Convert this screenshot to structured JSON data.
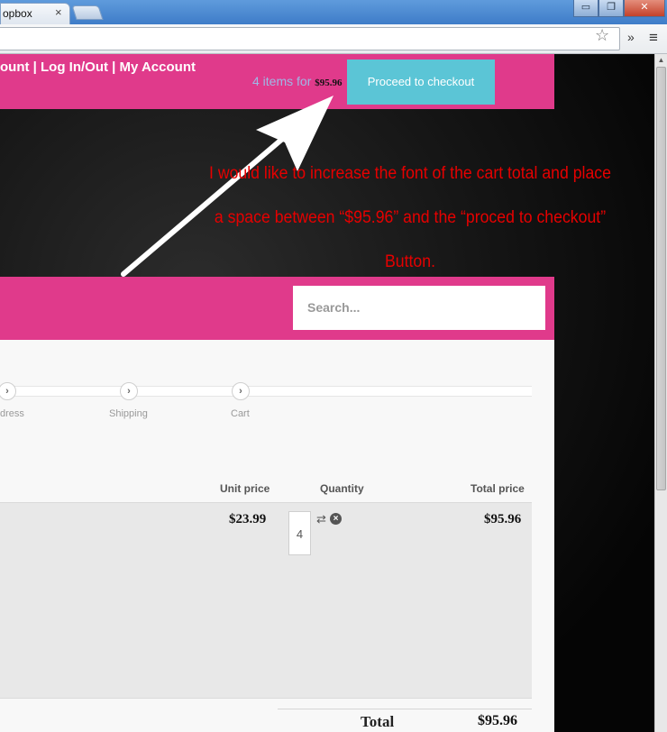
{
  "browser": {
    "tab_title": "opbox",
    "tab_close": "×",
    "window_min": "▭",
    "window_max": "❐",
    "window_close": "✕",
    "star_icon": "☆",
    "extensions_icon": "»",
    "menu_icon": "≡"
  },
  "header": {
    "account_links": "ount  | Log In/Out | My Account",
    "cart_count_text": "4 items for ",
    "cart_total": "$95.96",
    "checkout_label": "Proceed to checkout"
  },
  "annotation": {
    "line1": "I would like to increase the font of the cart total and place",
    "line2": "a space between “$95.96” and the “proced to checkout”",
    "line3": "Button."
  },
  "nav": {
    "search_placeholder": "Search..."
  },
  "steps": [
    {
      "icon": "›",
      "label": "dress"
    },
    {
      "icon": "›",
      "label": "Shipping"
    },
    {
      "icon": "›",
      "label": "Cart"
    }
  ],
  "table": {
    "headers": {
      "unit_price": "Unit price",
      "quantity": "Quantity",
      "total_price": "Total price"
    },
    "row": {
      "unit_price": "$23.99",
      "quantity": "4",
      "total_price": "$95.96"
    },
    "refresh_icon": "⇄",
    "remove_icon": "×"
  },
  "summary": {
    "total_label": "Total",
    "total_value": "$95.96"
  },
  "colors": {
    "brand_pink": "#e03a8b",
    "checkout_cyan": "#5bc5d6",
    "annotation_red": "#e60000"
  }
}
